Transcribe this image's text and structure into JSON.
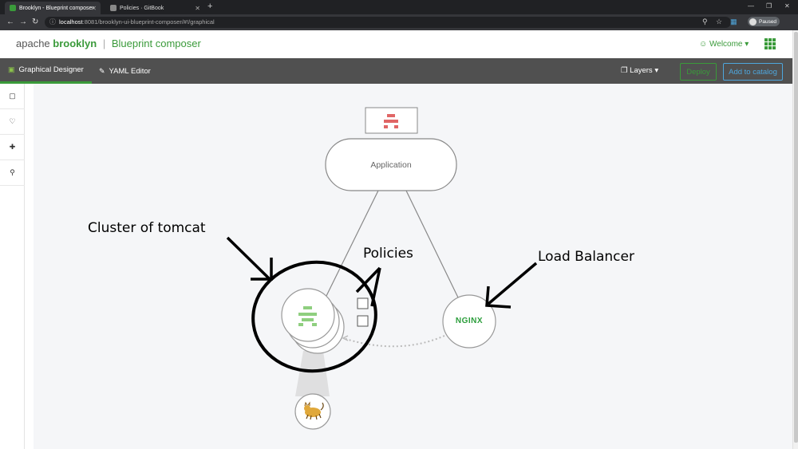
{
  "browser": {
    "tabs": [
      {
        "title": "Brooklyn - Blueprint composer"
      },
      {
        "title": "Policies · GitBook"
      }
    ],
    "url_host": "localhost",
    "url_rest": ":8081/brooklyn-ui-blueprint-composer/#!/graphical",
    "profile_status": "Paused"
  },
  "header": {
    "brand_prefix": "apache",
    "brand_name": "brooklyn",
    "product": "Blueprint composer",
    "welcome": "Welcome"
  },
  "nav": {
    "tabs": [
      {
        "label": "Graphical Designer",
        "icon": "sitemap-icon"
      },
      {
        "label": "YAML Editor",
        "icon": "pencil-icon"
      }
    ],
    "layers": "Layers",
    "deploy": "Deploy",
    "add_to_catalog": "Add to catalog"
  },
  "sidebar": {
    "items": [
      {
        "icon": "square-icon"
      },
      {
        "icon": "heartbeat-icon"
      },
      {
        "icon": "puzzle-icon"
      },
      {
        "icon": "location-pin-icon"
      }
    ]
  },
  "graph": {
    "application_label": "Application",
    "nginx_label": "NGINX",
    "colors": {
      "brooklyn_green": "#3a9a3a",
      "error_red": "#e06666",
      "nginx_green": "#2a9d3a"
    }
  },
  "annotations": {
    "cluster": "Cluster of tomcat",
    "policies": "Policies",
    "load_balancer": "Load Balancer"
  }
}
